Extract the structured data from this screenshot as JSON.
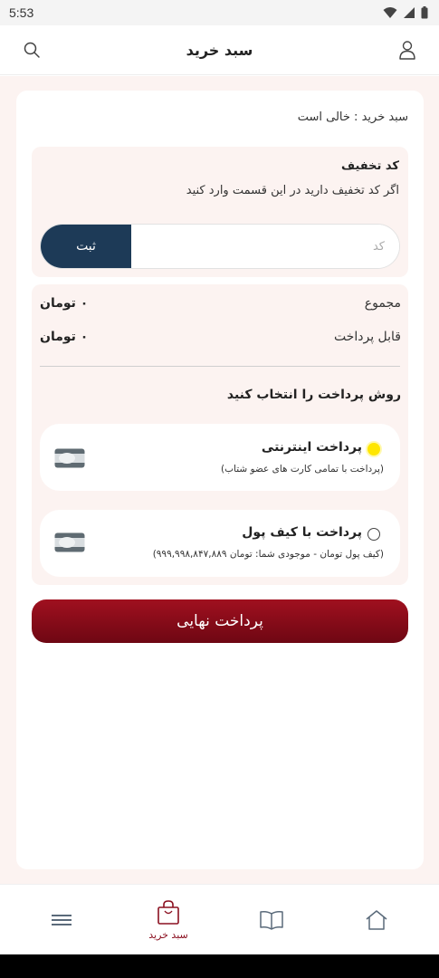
{
  "status_bar": {
    "time": "5:53"
  },
  "header": {
    "title": "سبد خرید"
  },
  "cart": {
    "status": "سبد خرید  :  خالی است"
  },
  "discount": {
    "title": "کد تخفیف",
    "description": "اگر کد تخفیف دارید در این قسمت وارد کنید",
    "input_placeholder": "کد",
    "submit_label": "ثبت"
  },
  "summary": {
    "total_label": "مجموع",
    "total_value": "۰ تومان",
    "payable_label": "قابل پرداخت",
    "payable_value": "۰ تومان"
  },
  "payment": {
    "section_title": "روش پرداخت را انتخاب کنید",
    "options": [
      {
        "title": "پرداخت اینترنتی",
        "description": "(پرداخت با تمامی کارت های عضو شتاب)",
        "selected": true
      },
      {
        "title": "پرداخت با کیف پول",
        "description": "(کیف پول تومان - موجودی شما: تومان ۹۹۹,۹۹۸,۸۴۷,۸۸۹)",
        "selected": false
      }
    ]
  },
  "final_button": {
    "label": "پرداخت نهایی"
  },
  "bottom_nav": {
    "items": [
      {
        "icon": "menu-icon",
        "label": ""
      },
      {
        "icon": "shopping-bag-icon",
        "label": "سبد خرید",
        "active": true
      },
      {
        "icon": "book-icon",
        "label": ""
      },
      {
        "icon": "home-icon",
        "label": ""
      }
    ]
  },
  "colors": {
    "accent": "#8b1020",
    "submit_button": "#1d3a57",
    "page_background": "#fcf3f1",
    "radio_selected": "#ffe600"
  }
}
